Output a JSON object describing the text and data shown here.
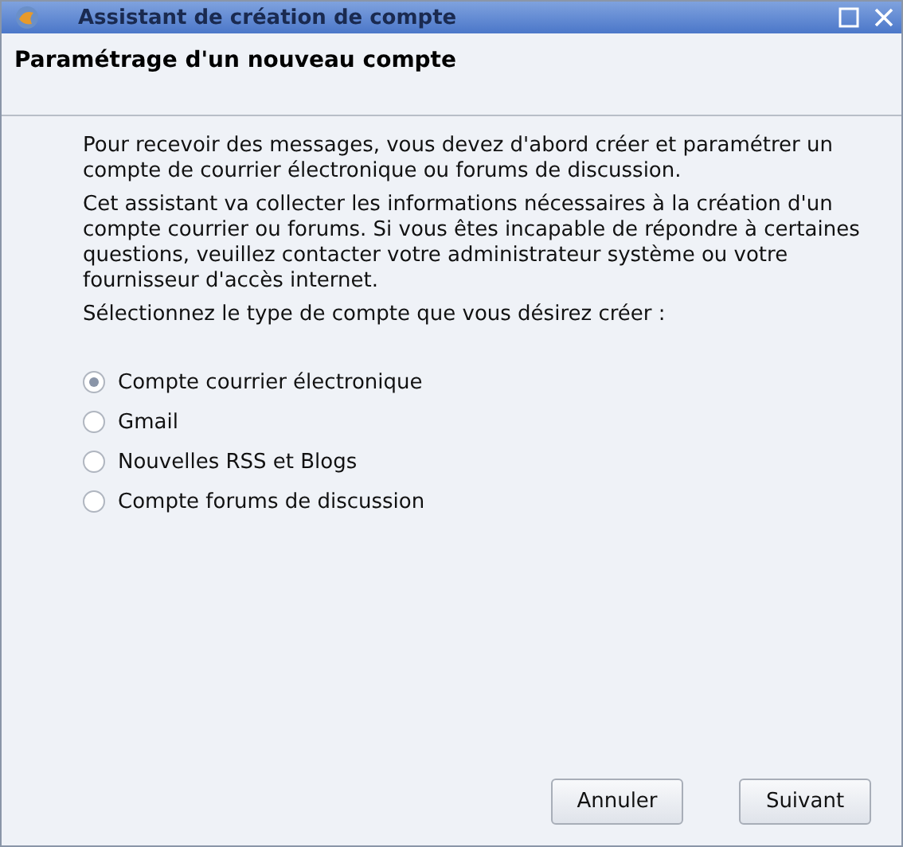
{
  "window": {
    "title": "Assistant de création de compte"
  },
  "header": {
    "title": "Paramétrage d'un nouveau compte"
  },
  "paragraphs": [
    "Pour recevoir des messages, vous devez d'abord créer et paramétrer un compte de courrier électronique ou forums de discussion.",
    "Cet assistant va collecter les informations nécessaires à la création d'un compte courrier ou forums. Si vous êtes incapable de répondre à certaines questions, veuillez contacter votre administrateur système ou votre fournisseur d'accès internet.",
    "Sélectionnez le type de compte que vous désirez créer :"
  ],
  "account_types": [
    {
      "label": "Compte courrier électronique",
      "selected": true
    },
    {
      "label": "Gmail",
      "selected": false
    },
    {
      "label": "Nouvelles RSS et Blogs",
      "selected": false
    },
    {
      "label": "Compte forums de discussion",
      "selected": false
    }
  ],
  "buttons": [
    "Annuler",
    "Suivant"
  ]
}
